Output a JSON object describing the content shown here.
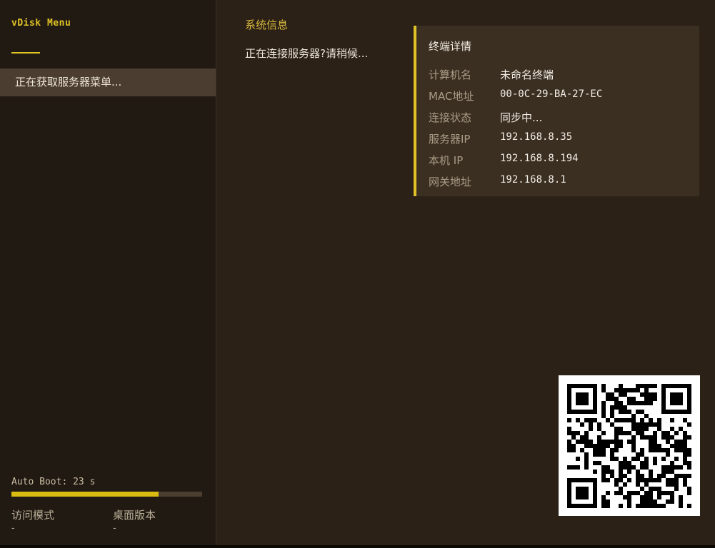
{
  "sidebar": {
    "brand": "vDisk Menu",
    "menu_item": "正在获取服务器菜单...",
    "autoboot_label": "Auto Boot:",
    "autoboot_seconds": "23 s",
    "autoboot_progress": 0.77,
    "access_mode_label": "访问模式",
    "access_mode_value": "-",
    "desktop_version_label": "桌面版本",
    "desktop_version_value": "-"
  },
  "main": {
    "section_title": "系统信息",
    "status_text": "正在连接服务器?请稍候..."
  },
  "terminal": {
    "title": "终端详情",
    "rows": [
      {
        "key": "计算机名",
        "value": "未命名终端"
      },
      {
        "key": "MAC地址",
        "value": "00-0C-29-BA-27-EC"
      },
      {
        "key": "连接状态",
        "value": "同步中..."
      },
      {
        "key": "服务器IP",
        "value": "192.168.8.35"
      },
      {
        "key": "本机 IP",
        "value": "192.168.8.194"
      },
      {
        "key": "网关地址",
        "value": "192.168.8.1"
      }
    ]
  },
  "colors": {
    "accent": "#e0c226",
    "background": "#2b2116",
    "sidebar": "#211a12",
    "panel": "#3b2f22",
    "selection": "#4b3e30"
  },
  "icons": {
    "qr": "qr-code-icon"
  }
}
